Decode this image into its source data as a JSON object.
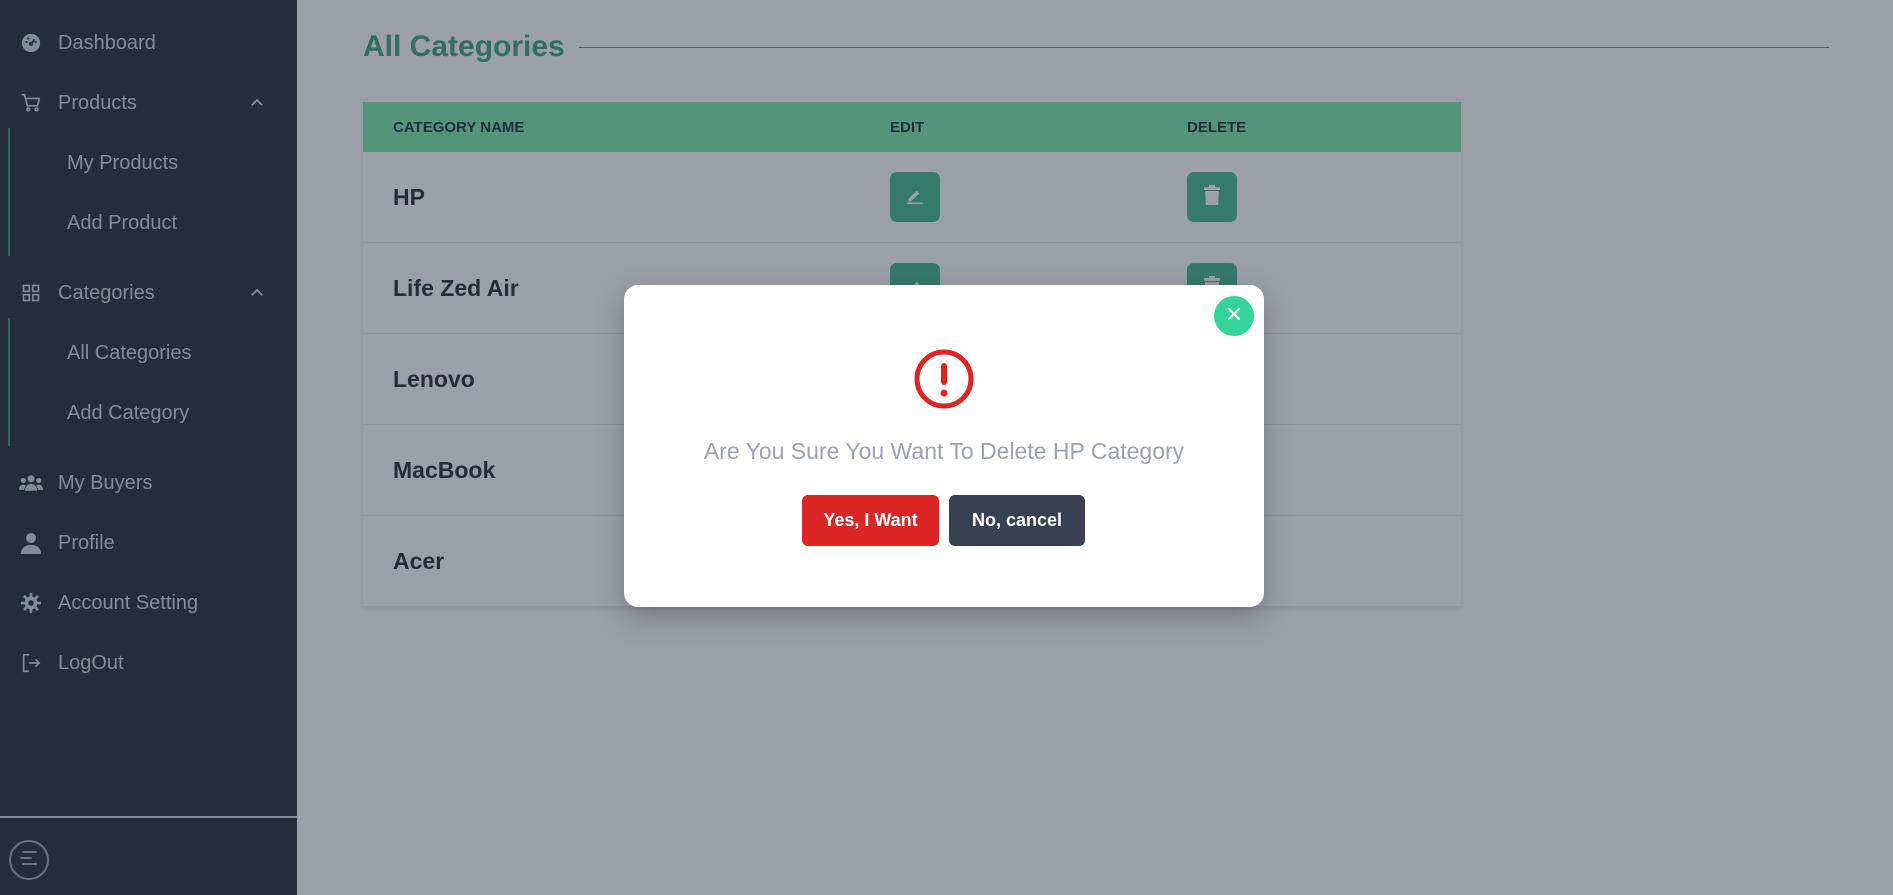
{
  "sidebar": {
    "items": [
      {
        "label": "Dashboard",
        "icon": "dashboard-gauge-icon"
      },
      {
        "label": "Products",
        "icon": "cart-icon"
      },
      {
        "label": "My Products"
      },
      {
        "label": "Add Product"
      },
      {
        "label": "Categories",
        "icon": "grid-icon"
      },
      {
        "label": "All Categories"
      },
      {
        "label": "Add Category"
      },
      {
        "label": "My Buyers",
        "icon": "users-icon"
      },
      {
        "label": "Profile",
        "icon": "user-icon"
      },
      {
        "label": "Account Setting",
        "icon": "gear-icon"
      },
      {
        "label": "LogOut",
        "icon": "logout-icon"
      }
    ]
  },
  "main": {
    "title": "All Categories",
    "table": {
      "headers": [
        "CATEGORY NAME",
        "EDIT",
        "DELETE"
      ],
      "rows": [
        "HP",
        "Life Zed Air",
        "Lenovo",
        "MacBook",
        "Acer"
      ]
    }
  },
  "modal": {
    "message": "Are You Sure You Want To Delete HP Category",
    "confirm_label": "Yes, I Want",
    "cancel_label": "No, cancel"
  },
  "colors": {
    "sidebar_bg": "#111827",
    "accent_green": "#2f9a6a",
    "table_header": "#6ee7a5",
    "action_button": "#34b383",
    "danger": "#dc2626",
    "cancel": "#374151"
  }
}
